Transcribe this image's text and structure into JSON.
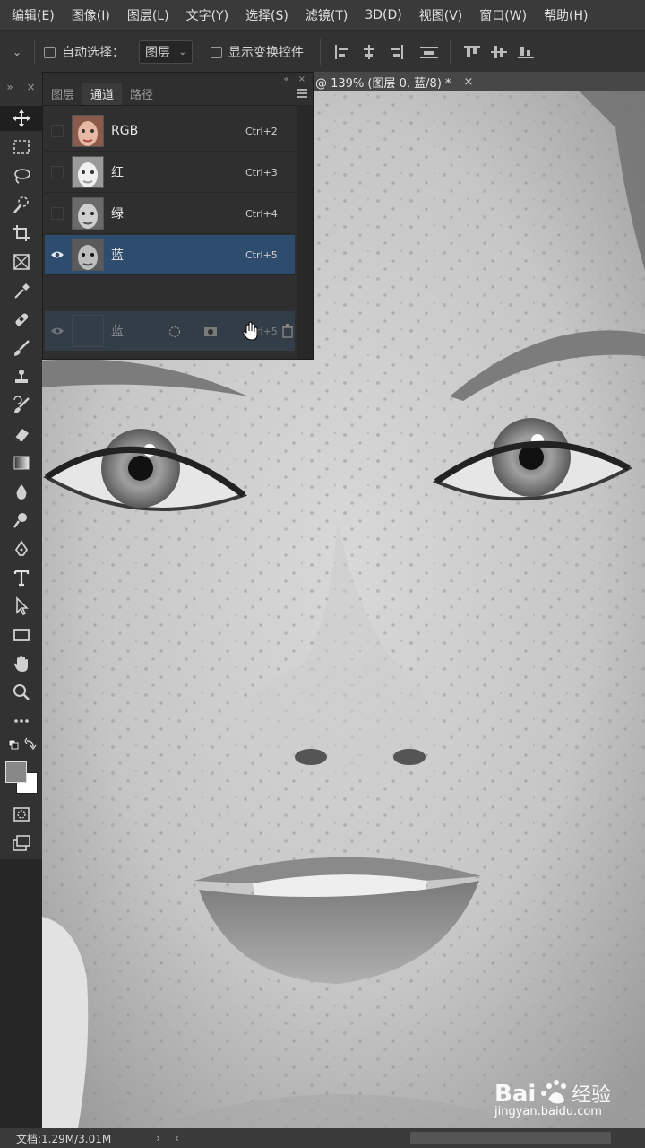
{
  "menu": [
    "编辑(E)",
    "图像(I)",
    "图层(L)",
    "文字(Y)",
    "选择(S)",
    "滤镜(T)",
    "3D(D)",
    "视图(V)",
    "窗口(W)",
    "帮助(H)"
  ],
  "options": {
    "auto_select_label": "自动选择：",
    "auto_select_target": "图层",
    "show_transform_label": "显示变换控件"
  },
  "document": {
    "tab_title": "@ 139% (图层 0, 蓝/8) *",
    "close_glyph": "×"
  },
  "panel": {
    "tabs": [
      "图层",
      "通道",
      "路径"
    ],
    "active_tab": 1,
    "channels": [
      {
        "name": "RGB",
        "shortcut": "Ctrl+2",
        "visible": false,
        "selected": false
      },
      {
        "name": "红",
        "shortcut": "Ctrl+3",
        "visible": false,
        "selected": false
      },
      {
        "name": "绿",
        "shortcut": "Ctrl+4",
        "visible": false,
        "selected": false
      },
      {
        "name": "蓝",
        "shortcut": "Ctrl+5",
        "visible": true,
        "selected": true
      }
    ],
    "drag_ghost": {
      "name": "蓝",
      "shortcut": "Ctrl+5"
    }
  },
  "status": {
    "doc_info": "文档:1.29M/3.01M"
  },
  "watermark": {
    "brand": "Baidu 经验",
    "url": "jingyan.baidu.com"
  },
  "colors": {
    "selection": "#2d4c6e",
    "foreground": "#888888",
    "background": "#ffffff"
  }
}
